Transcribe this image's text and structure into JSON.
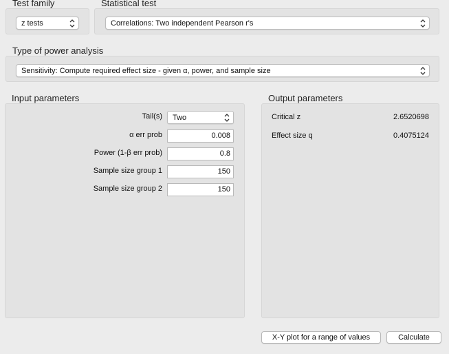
{
  "test_family": {
    "label": "Test family",
    "value": "z tests"
  },
  "statistical_test": {
    "label": "Statistical test",
    "value": "Correlations: Two independent Pearson r's"
  },
  "power_analysis": {
    "label": "Type of power analysis",
    "value": "Sensitivity: Compute required effect size - given α, power, and sample size"
  },
  "input_parameters": {
    "title": "Input parameters",
    "tails": {
      "label": "Tail(s)",
      "value": "Two"
    },
    "alpha": {
      "label": "α err prob",
      "value": "0.008"
    },
    "power": {
      "label": "Power (1-β err prob)",
      "value": "0.8"
    },
    "n1": {
      "label": "Sample size group 1",
      "value": "150"
    },
    "n2": {
      "label": "Sample size group 2",
      "value": "150"
    }
  },
  "output_parameters": {
    "title": "Output parameters",
    "critical_z": {
      "label": "Critical z",
      "value": "2.6520698"
    },
    "effect_size": {
      "label": "Effect size q",
      "value": "0.4075124"
    }
  },
  "buttons": {
    "xy_plot": "X-Y plot for a range of values",
    "calculate": "Calculate"
  }
}
